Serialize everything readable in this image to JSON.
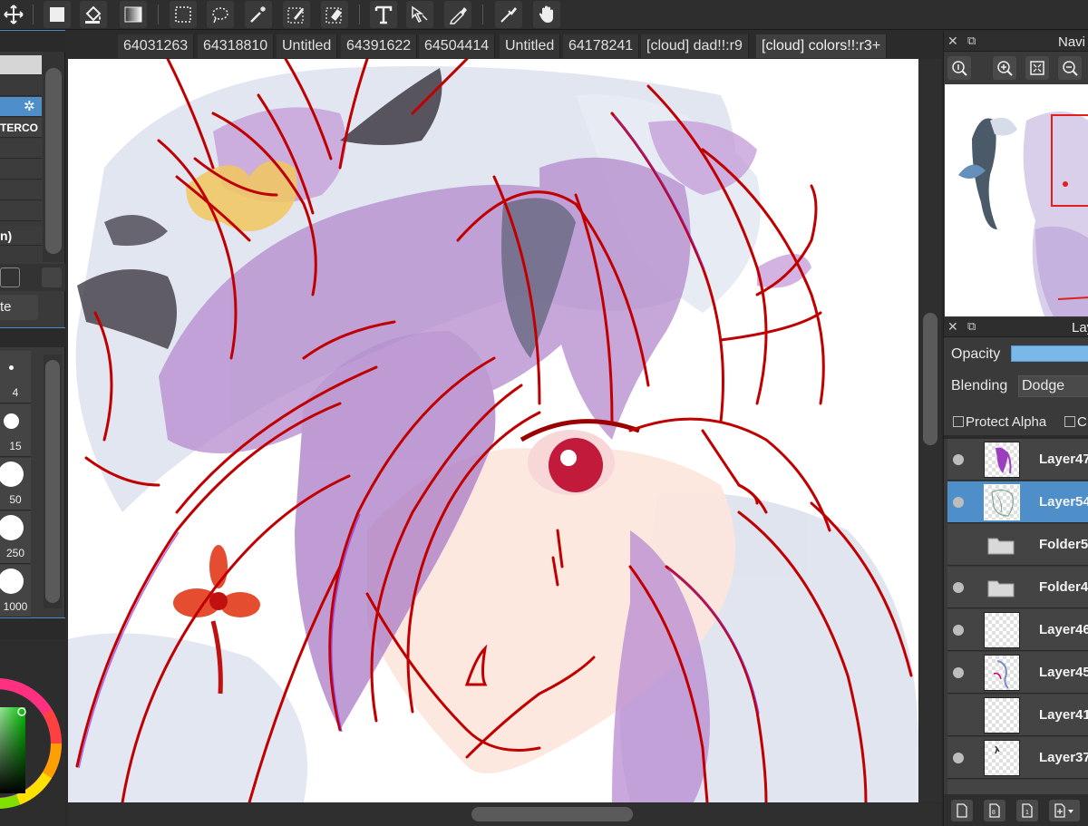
{
  "toolbar": {
    "tools": [
      "move-icon",
      "rectangle-fill-icon",
      "bucket-fill-icon",
      "gradient-icon",
      "rect-select-icon",
      "lasso-select-icon",
      "magic-wand-icon",
      "select-pen-icon",
      "select-eraser-icon",
      "text-icon",
      "transform-icon",
      "eyedropper-icon",
      "eyedropper2-icon",
      "hand-icon"
    ]
  },
  "tabs": [
    {
      "label": "64031263"
    },
    {
      "label": "64318810"
    },
    {
      "label": "Untitled"
    },
    {
      "label": "64391622"
    },
    {
      "label": "64504414"
    },
    {
      "label": "Untitled"
    },
    {
      "label": "64178241"
    },
    {
      "label": "[cloud] dad!!:r9"
    },
    {
      "label": "[cloud] colors!!:r3+"
    }
  ],
  "left_panel": {
    "rows": [
      "",
      "",
      "",
      "TERCO",
      "",
      "",
      "",
      "n)"
    ],
    "button_label": "te",
    "brush_sizes": [
      "4",
      "15",
      "50",
      "250",
      "1000"
    ]
  },
  "navigator": {
    "title": "Navi"
  },
  "layers_panel": {
    "title": "Lay",
    "opacity_label": "Opacity",
    "opacity_value": 1.0,
    "blending_label": "Blending",
    "blending_value": "Dodge",
    "protect_alpha_label": "Protect Alpha",
    "clipping_label": "C",
    "layers": [
      {
        "name": "Layer47",
        "visible": true,
        "type": "layer"
      },
      {
        "name": "Layer54",
        "visible": true,
        "type": "layer",
        "selected": true
      },
      {
        "name": "Folder5",
        "visible": false,
        "type": "folder"
      },
      {
        "name": "Folder4",
        "visible": true,
        "type": "folder"
      },
      {
        "name": "Layer46",
        "visible": true,
        "type": "layer"
      },
      {
        "name": "Layer45",
        "visible": true,
        "type": "layer"
      },
      {
        "name": "Layer41",
        "visible": false,
        "type": "layer"
      },
      {
        "name": "Layer37",
        "visible": true,
        "type": "layer"
      }
    ]
  },
  "colors": {
    "accent": "#4f8fc9",
    "opacity_bar": "#7bb8ea",
    "panel_bg": "#3a3a3a",
    "toolbar_bg": "#2e2e2e",
    "hair_purple": "#b07cc6",
    "line_red": "#c00000"
  }
}
